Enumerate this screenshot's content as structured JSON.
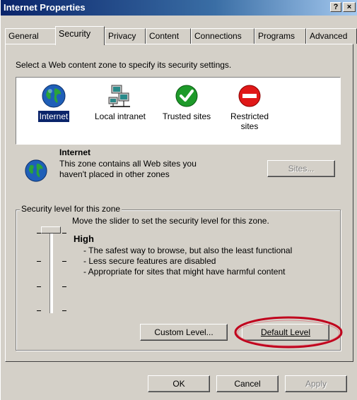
{
  "window": {
    "title": "Internet Properties",
    "help_label": "?",
    "close_label": "×"
  },
  "tabs": [
    {
      "label": "General"
    },
    {
      "label": "Security",
      "active": true
    },
    {
      "label": "Privacy"
    },
    {
      "label": "Content"
    },
    {
      "label": "Connections"
    },
    {
      "label": "Programs"
    },
    {
      "label": "Advanced"
    }
  ],
  "instruction": "Select a Web content zone to specify its security settings.",
  "zones": [
    {
      "label": "Internet",
      "icon": "globe-icon",
      "selected": true
    },
    {
      "label": "Local intranet",
      "icon": "network-computers-icon"
    },
    {
      "label": "Trusted sites",
      "icon": "green-check-icon"
    },
    {
      "label": "Restricted sites",
      "icon": "red-no-entry-icon"
    }
  ],
  "zone_info": {
    "name": "Internet",
    "description_line1": "This zone contains all Web sites you",
    "description_line2": "haven't placed in other zones",
    "sites_button": "Sites..."
  },
  "security_level": {
    "group_label": "Security level for this zone",
    "hint": "Move the slider to set the security level for this zone.",
    "level_name": "High",
    "bullets": [
      "- The safest way to browse, but also the least functional",
      "- Less secure features are disabled",
      "- Appropriate for sites that might have harmful content"
    ],
    "custom_level_button": "Custom Level...",
    "default_level_button": "Default Level"
  },
  "footer": {
    "ok_label": "OK",
    "cancel_label": "Cancel",
    "apply_label": "Apply"
  },
  "colors": {
    "title_bar": "#0a246a",
    "dialog_bg": "#d4d0c8",
    "highlight_oval": "#c0001c",
    "selection": "#0a246a"
  }
}
